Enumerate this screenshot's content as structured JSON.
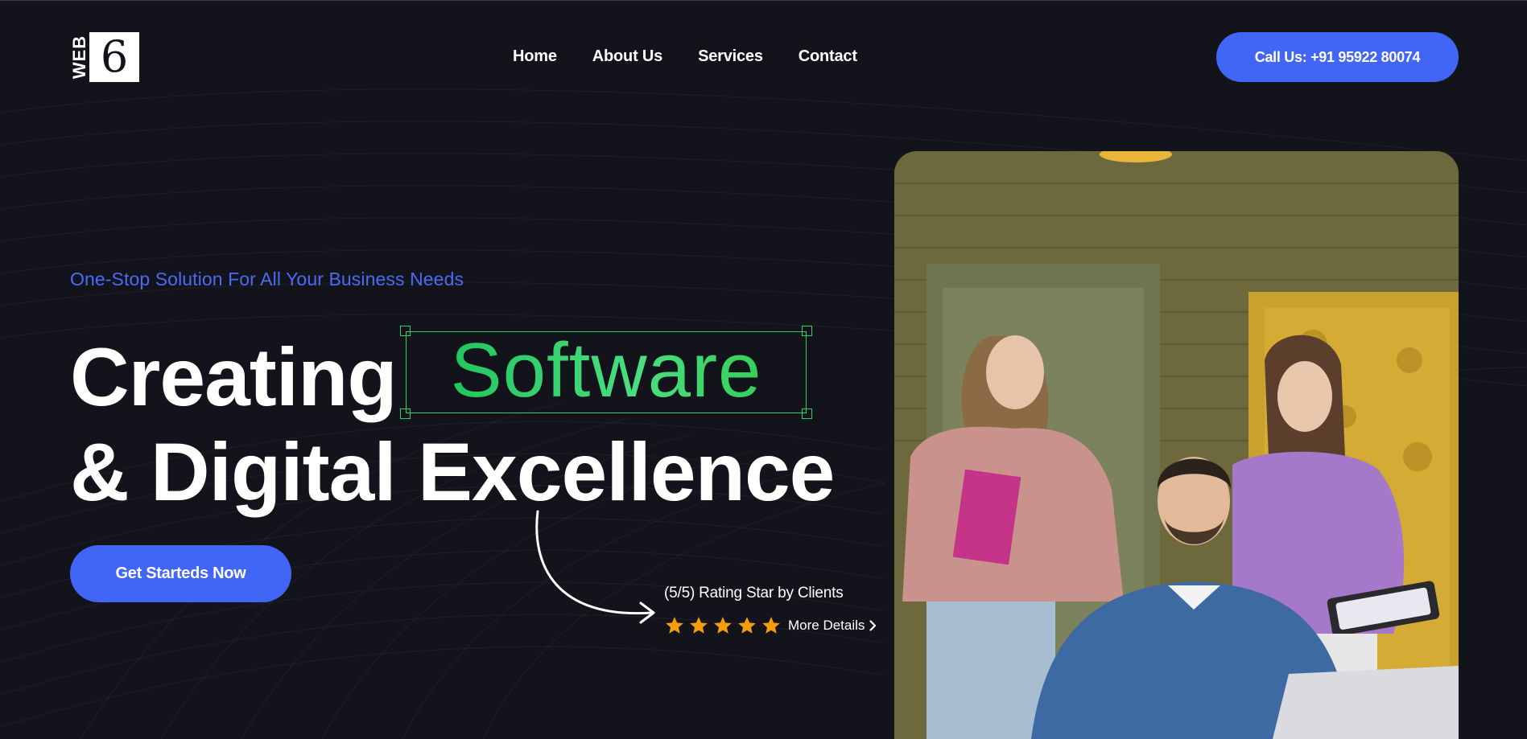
{
  "header": {
    "logo_text": "WEB",
    "logo_mark": "6",
    "nav": [
      {
        "label": "Home"
      },
      {
        "label": "About Us"
      },
      {
        "label": "Services"
      },
      {
        "label": "Contact"
      }
    ],
    "call_button": "Call Us: +91 95922 80074"
  },
  "hero": {
    "tagline": "One-Stop Solution For All Your Business Needs",
    "headline_start": "Creating",
    "highlight_word": "Software",
    "headline_line2": "& Digital Excellence",
    "cta_label": "Get Starteds Now",
    "rating_text": "(5/5) Rating Star by Clients",
    "stars": 5,
    "more_details": "More Details"
  },
  "colors": {
    "background": "#13141b",
    "accent_blue": "#4166f5",
    "highlight_green": "#2ed170",
    "star_orange": "#f59e0b"
  },
  "icons": [
    "star-icon",
    "chevron-right-icon",
    "curved-arrow-icon"
  ]
}
